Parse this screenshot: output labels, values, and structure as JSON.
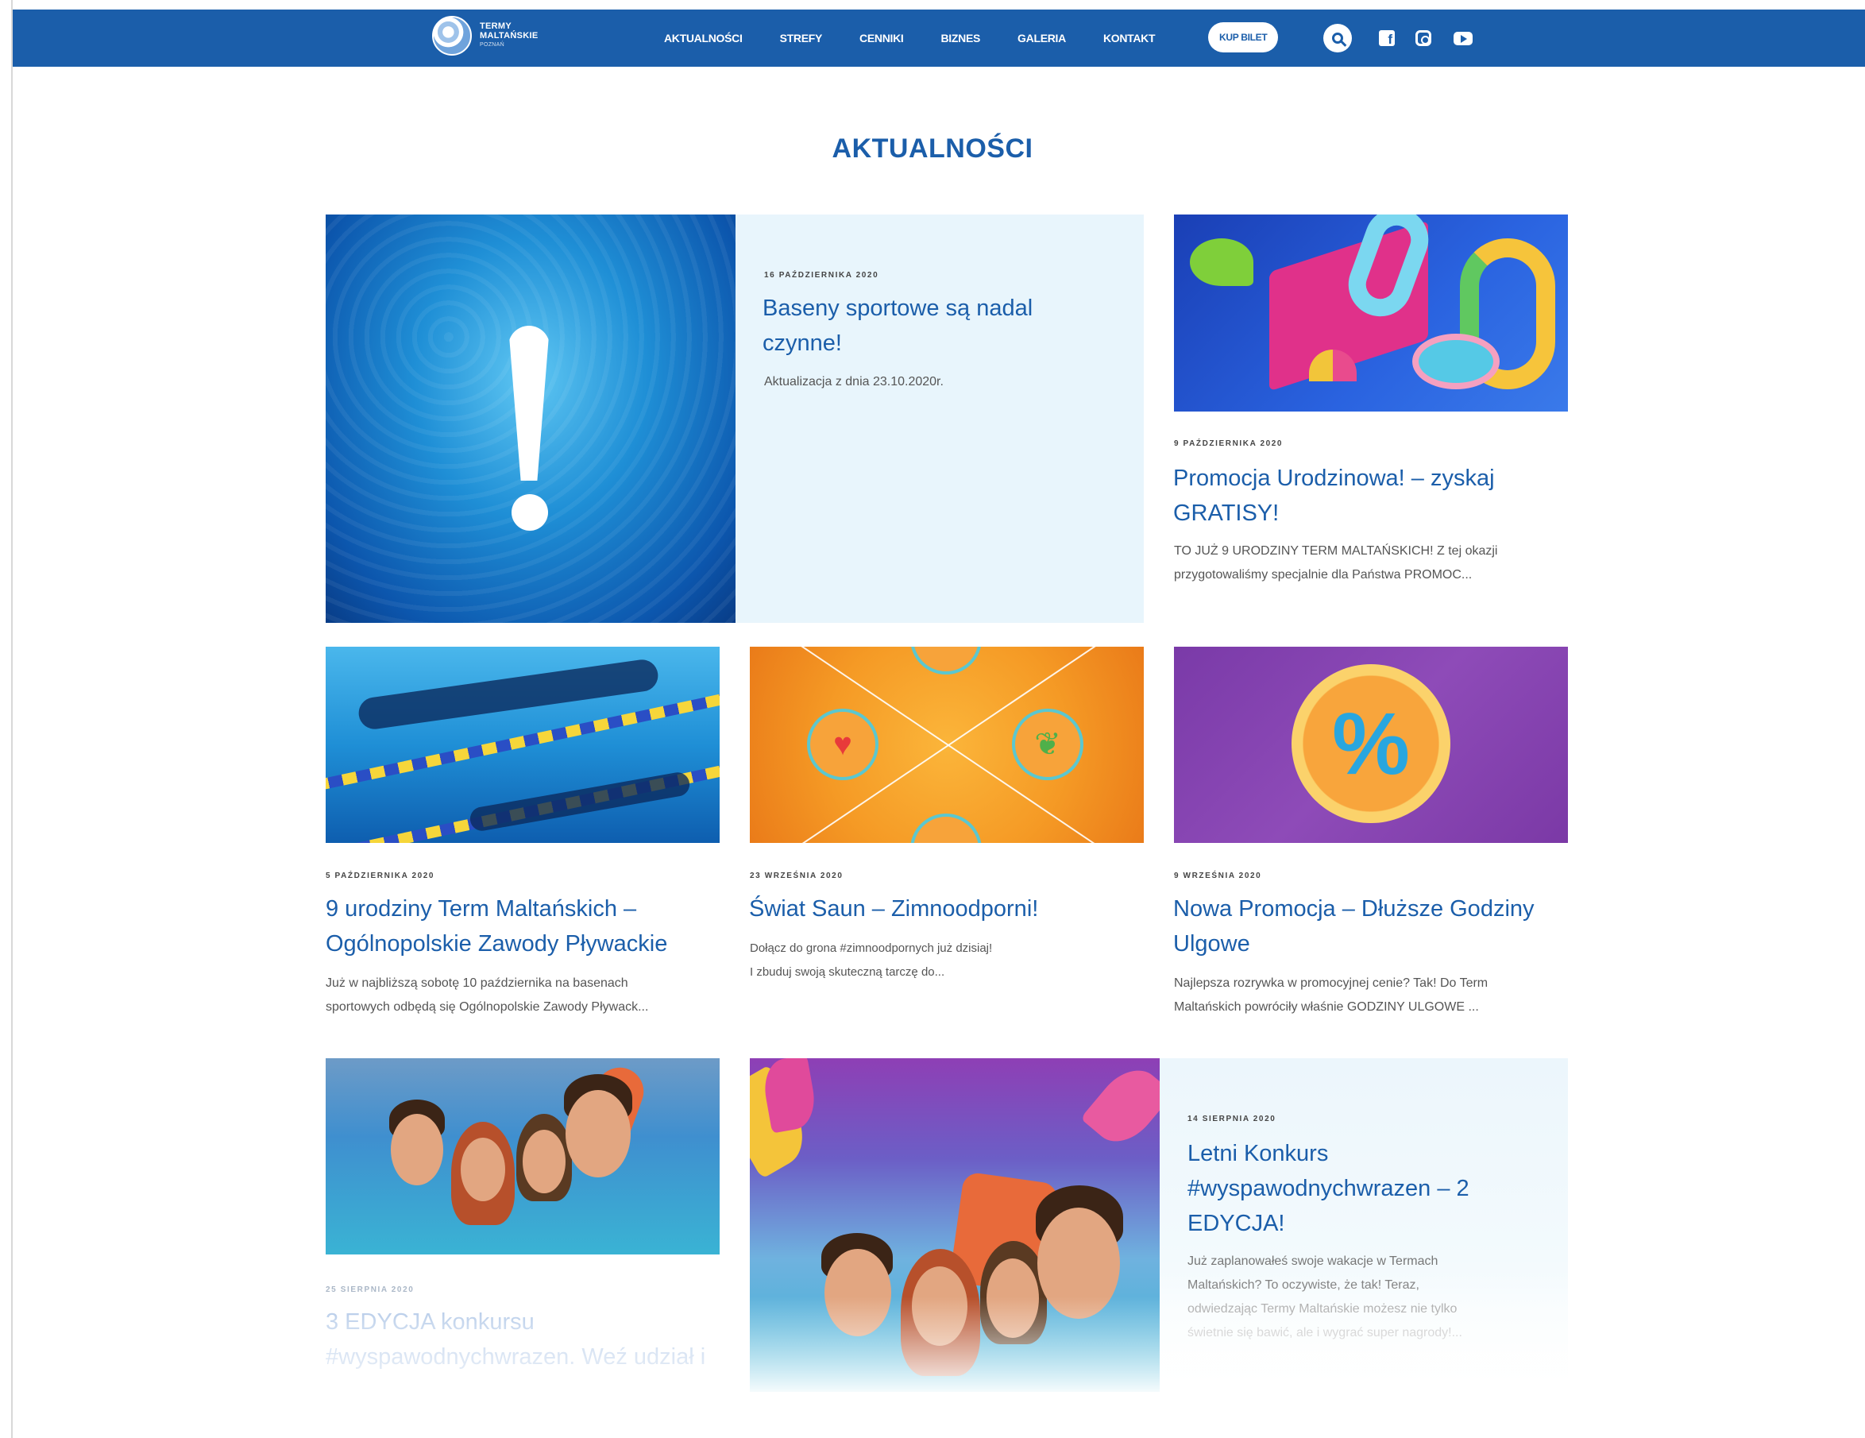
{
  "header": {
    "logo_line1": "TERMY",
    "logo_line2": "MALTAŃSKIE",
    "logo_line3": "POZNAŃ",
    "nav": [
      "AKTUALNOŚCI",
      "STREFY",
      "CENNIKI",
      "BIZNES",
      "GALERIA",
      "KONTAKT"
    ],
    "buy_label": "KUP BILET",
    "icons": [
      "search-icon",
      "facebook-icon",
      "instagram-icon",
      "youtube-icon"
    ],
    "color": "#1b5eaa"
  },
  "page_title": "AKTUALNOŚCI",
  "posts": [
    {
      "date": "16 PAŹDZIERNIKA 2020",
      "title_l1": "Baseny sportowe są nadal",
      "title_l2": "czynne!",
      "excerpt_l1": "Aktualizacja z dnia 23.10.2020r."
    },
    {
      "date": "9 PAŹDZIERNIKA 2020",
      "title_l1": "Promocja Urodzinowa! – zyskaj",
      "title_l2": "GRATISY!",
      "excerpt_l1": "TO JUŻ 9 URODZINY TERM MALTAŃSKICH! Z tej okazji",
      "excerpt_l2": "przygotowaliśmy specjalnie dla Państwa PROMOC..."
    },
    {
      "date": "5 PAŹDZIERNIKA 2020",
      "title_l1": "9 urodziny Term Maltańskich –",
      "title_l2": "Ogólnopolskie Zawody Pływackie",
      "excerpt_l1": "Już w najbliższą sobotę 10 października na basenach",
      "excerpt_l2": "sportowych odbędą się Ogólnopolskie Zawody Pływack..."
    },
    {
      "date": "23 WRZEŚNIA 2020",
      "title_l1": "Świat Saun – Zimnoodporni!",
      "excerpt_l1": "Dołącz do grona #zimnoodpornych już dzisiaj!",
      "excerpt_l2": "I zbuduj swoją skuteczną tarczę do..."
    },
    {
      "date": "9 WRZEŚNIA 2020",
      "title_l1": "Nowa Promocja – Dłuższe Godziny",
      "title_l2": "Ulgowe",
      "excerpt_l1": "Najlepsza rozrywka w promocyjnej cenie? Tak! Do Term",
      "excerpt_l2": "Maltańskich powróciły właśnie GODZINY ULGOWE ..."
    },
    {
      "date": "25 SIERPNIA 2020",
      "title_l1": "3 EDYCJA konkursu",
      "title_l2": "#wyspawodnychwrazen. Weź udział i"
    },
    {
      "date": "14 SIERPNIA 2020",
      "title_l1": "Letni Konkurs",
      "title_l2": "#wyspawodnychwrazen – 2",
      "title_l3": "EDYCJA!",
      "excerpt_l1": "Już zaplanowałeś swoje wakacje w Termach",
      "excerpt_l2": "Maltańskich? To oczywiste, że tak! Teraz,",
      "excerpt_l3": "odwiedzając Termy Maltańskie możesz nie tylko",
      "excerpt_l4": "świetnie się bawić, ale i wygrać super nagrody!..."
    }
  ]
}
